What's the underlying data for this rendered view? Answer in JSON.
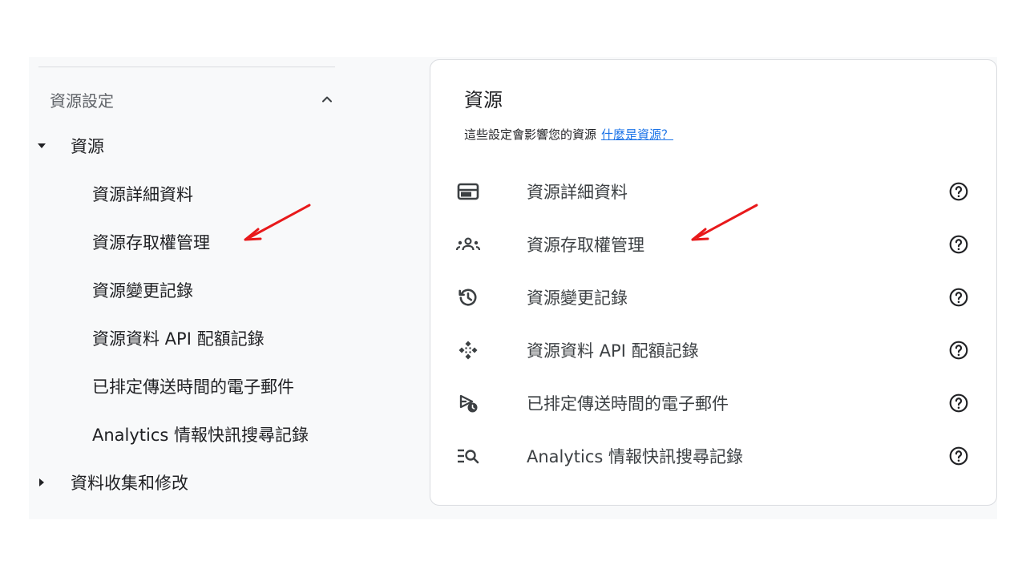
{
  "sidebar": {
    "section_title": "資源設定",
    "groups": [
      {
        "label": "資源",
        "expanded": true,
        "items": [
          {
            "label": "資源詳細資料"
          },
          {
            "label": "資源存取權管理"
          },
          {
            "label": "資源變更記錄"
          },
          {
            "label": "資源資料 API 配額記錄"
          },
          {
            "label": "已排定傳送時間的電子郵件"
          },
          {
            "label": "Analytics 情報快訊搜尋記錄"
          }
        ]
      },
      {
        "label": "資料收集和修改",
        "expanded": false
      }
    ]
  },
  "card": {
    "title": "資源",
    "subtitle": "這些設定會影響您的資源",
    "link": "什麼是資源？",
    "rows": [
      {
        "icon": "property-details-icon",
        "label": "資源詳細資料"
      },
      {
        "icon": "people-access-icon",
        "label": "資源存取權管理"
      },
      {
        "icon": "history-icon",
        "label": "資源變更記錄"
      },
      {
        "icon": "api-diamond-icon",
        "label": "資源資料 API 配額記錄"
      },
      {
        "icon": "scheduled-email-icon",
        "label": "已排定傳送時間的電子郵件"
      },
      {
        "icon": "search-log-icon",
        "label": "Analytics 情報快訊搜尋記錄"
      }
    ]
  },
  "colors": {
    "accent": "#1a73e8",
    "annotation_arrow": "#e8191b",
    "icon": "#3c4043"
  }
}
